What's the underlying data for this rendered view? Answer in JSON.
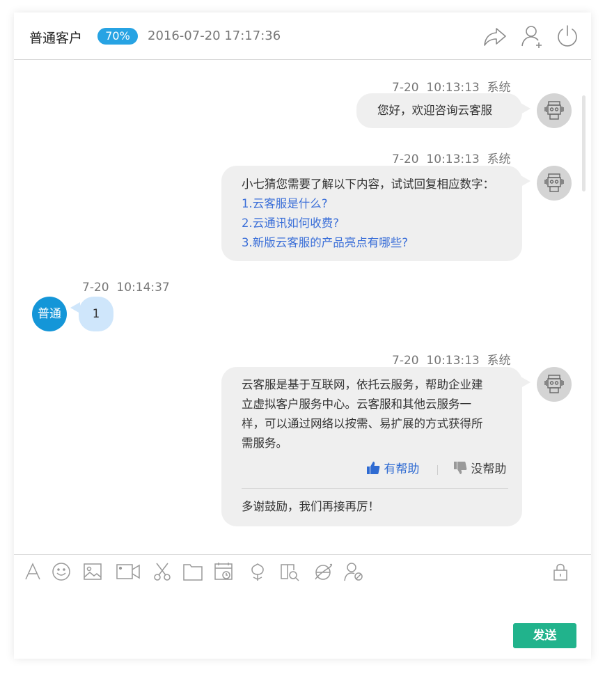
{
  "header": {
    "title": "普通客户",
    "badge": "70%",
    "datetime": "2016-07-20 17:17:36",
    "icons": [
      "share-icon",
      "add-user-icon",
      "power-icon"
    ]
  },
  "messages": [
    {
      "from": "bot",
      "time": "7-20  10:13:13  系统",
      "lines": [
        "您好，欢迎咨询云客服"
      ]
    },
    {
      "from": "bot",
      "time": "7-20  10:13:13  系统",
      "lines": [
        "小七猜您需要了解以下内容，试试回复相应数字："
      ],
      "links": [
        "1.云客服是什么?",
        "2.云通讯如何收费?",
        "3.新版云客服的产品亮点有哪些?"
      ]
    },
    {
      "from": "user",
      "time": "7-20  10:14:37",
      "avatar_label": "普通",
      "lines": [
        "1"
      ]
    },
    {
      "from": "bot",
      "time": "7-20  10:13:13  系统",
      "lines": [
        "云客服是基于互联网，依托云服务，帮助企业建",
        "立虚拟客户服务中心。云客服和其他云服务一",
        "样，可以通过网络以按需、易扩展的方式获得所",
        "需服务。"
      ],
      "helpful": "有帮助",
      "unhelpful": "没帮助",
      "thanks": "多谢鼓励，我们再接再厉！"
    }
  ],
  "toolbar": {
    "icons": [
      "font-icon",
      "emoji-icon",
      "image-icon",
      "video-icon",
      "scissors-icon",
      "folder-icon",
      "calendar-clock-icon",
      "flower-icon",
      "book-search-icon",
      "browser-icon",
      "user-block-icon",
      "lock-icon"
    ]
  },
  "composer": {
    "send_label": "发送"
  },
  "colors": {
    "badge": "#27a3e3",
    "user_avatar": "#1496d8",
    "user_bubble": "#cfe6fb",
    "link": "#3b6fd8",
    "send": "#21b38c",
    "bot_bubble": "#efefef"
  }
}
